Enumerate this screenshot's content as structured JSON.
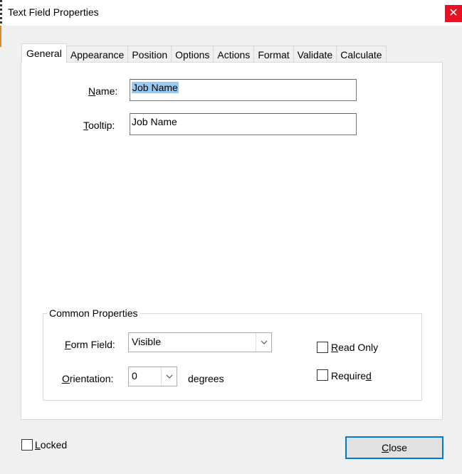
{
  "window": {
    "title": "Text Field Properties",
    "close_glyph": "✕"
  },
  "tabs": [
    {
      "label": "General"
    },
    {
      "label": "Appearance"
    },
    {
      "label": "Position"
    },
    {
      "label": "Options"
    },
    {
      "label": "Actions"
    },
    {
      "label": "Format"
    },
    {
      "label": "Validate"
    },
    {
      "label": "Calculate"
    }
  ],
  "general": {
    "name_label": {
      "pre": "",
      "key": "N",
      "post": "ame:"
    },
    "name_value": "Job Name",
    "tooltip_label": {
      "pre": "",
      "key": "T",
      "post": "ooltip:"
    },
    "tooltip_value": "Job Name"
  },
  "common": {
    "legend": "Common Properties",
    "form_field_label": {
      "pre": "",
      "key": "F",
      "post": "orm Field:"
    },
    "form_field_value": "Visible",
    "orientation_label": {
      "pre": "",
      "key": "O",
      "post": "rientation:"
    },
    "orientation_value": "0",
    "degrees_label": "degrees",
    "read_only": {
      "pre": "",
      "key": "R",
      "post": "ead Only",
      "checked": false
    },
    "required": {
      "pre": "Require",
      "key": "d",
      "post": "",
      "checked": false
    }
  },
  "footer": {
    "locked": {
      "pre": "",
      "key": "L",
      "post": "ocked",
      "checked": false
    },
    "close_button": {
      "pre": "",
      "key": "C",
      "post": "lose"
    }
  },
  "icons": {
    "dropdown": "chevron-down-icon",
    "close": "close-icon"
  }
}
